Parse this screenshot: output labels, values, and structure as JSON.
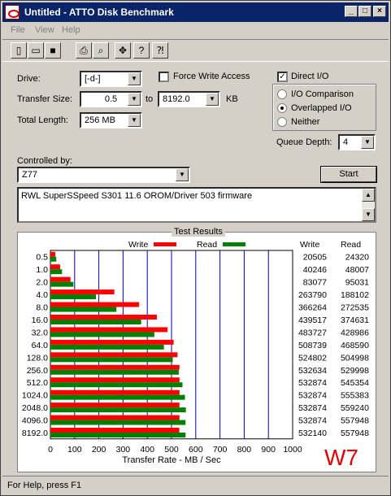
{
  "window": {
    "title": "Untitled - ATTO Disk Benchmark"
  },
  "menu": {
    "file": "File",
    "view": "View",
    "help": "Help"
  },
  "settings": {
    "drive_label": "Drive:",
    "drive_value": "[-d-]",
    "transfer_size_label": "Transfer Size:",
    "transfer_from": "0.5",
    "to_label": "to",
    "transfer_to": "8192.0",
    "kb_label": "KB",
    "total_length_label": "Total Length:",
    "total_length_value": "256 MB",
    "force_write_label": "Force Write Access",
    "direct_io_label": "Direct I/O",
    "direct_io_checked": true,
    "io_comparison_label": "I/O Comparison",
    "overlapped_io_label": "Overlapped I/O",
    "neither_label": "Neither",
    "queue_depth_label": "Queue Depth:",
    "queue_depth_value": "4",
    "controlled_by_label": "Controlled by:",
    "controlled_by_value": "Z77",
    "start_label": "Start",
    "description": "RWL SuperSSpeed S301 11.6 OROM/Driver 503 firmware"
  },
  "results": {
    "caption": "Test Results",
    "write_legend": "Write",
    "read_legend": "Read",
    "write_col": "Write",
    "read_col": "Read",
    "write_color": "#ff0000",
    "read_color": "#008000"
  },
  "chart_data": {
    "type": "bar",
    "categories": [
      "0.5",
      "1.0",
      "2.0",
      "4.0",
      "8.0",
      "16.0",
      "32.0",
      "64.0",
      "128.0",
      "256.0",
      "512.0",
      "1024.0",
      "2048.0",
      "4096.0",
      "8192.0"
    ],
    "series": [
      {
        "name": "Write",
        "values": [
          20505,
          40246,
          83077,
          263790,
          366264,
          439517,
          483727,
          508739,
          524802,
          532634,
          532874,
          532874,
          532874,
          532874,
          532140
        ]
      },
      {
        "name": "Read",
        "values": [
          24320,
          48007,
          95031,
          188102,
          272535,
          374631,
          428986,
          468590,
          504998,
          529998,
          545354,
          555383,
          559240,
          557948,
          557948
        ]
      }
    ],
    "xlabel": "Transfer Rate - MB / Sec",
    "xticks": [
      "0",
      "100",
      "200",
      "300",
      "400",
      "500",
      "600",
      "700",
      "800",
      "900",
      "1000"
    ],
    "xlim": [
      0,
      1000
    ]
  },
  "status": {
    "text": "For Help, press F1"
  },
  "watermark": "W7"
}
